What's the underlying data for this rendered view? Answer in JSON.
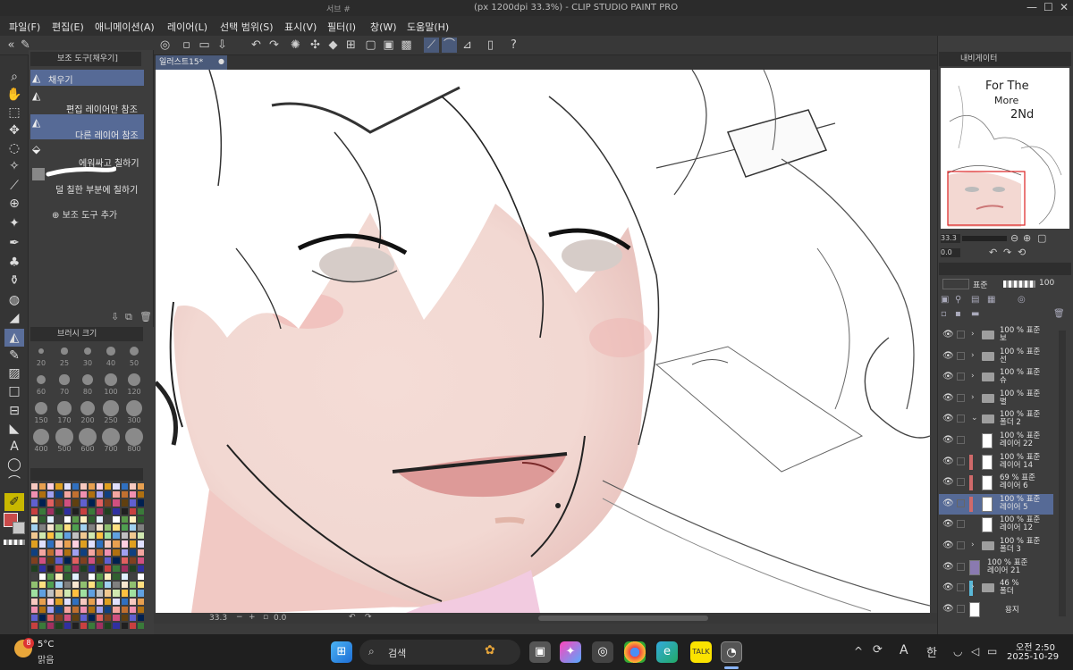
{
  "window": {
    "title_left": "서브 #",
    "title": "(px 1200dpi 33.3%) - CLIP STUDIO PAINT PRO",
    "min": "—",
    "max": "☐",
    "close": "✕"
  },
  "menu": [
    "파일(F)",
    "편집(E)",
    "애니메이션(A)",
    "레이어(L)",
    "선택 범위(S)",
    "표시(V)",
    "필터(I)",
    "창(W)",
    "도움말(H)"
  ],
  "subtool_panel": {
    "title": "보조 도구[채우기]",
    "header_item": "채우기",
    "items": [
      "편집 레이어만 참조",
      "다른 레이어 참조",
      "에워싸고 칠하기",
      "덜 칠한 부분에 칠하기"
    ],
    "add_label": "보조 도구 추가"
  },
  "brush_panel": {
    "title": "브러시 크기",
    "sizes": [
      "20",
      "25",
      "30",
      "40",
      "50",
      "60",
      "70",
      "80",
      "100",
      "120",
      "150",
      "170",
      "200",
      "250",
      "300",
      "400",
      "500",
      "600",
      "700",
      "800"
    ]
  },
  "canvas": {
    "tab_label": "일러스트15*",
    "zoom": "33.3",
    "angle": "0.0"
  },
  "navigator": {
    "title": "내비게이터",
    "thumb_text_1": "For The",
    "thumb_text_2": "More",
    "thumb_text_3": "2Nd",
    "zoom": "33.3",
    "angle": "0.0"
  },
  "layer_panel": {
    "blend": "표준",
    "opacity": "100",
    "layers": [
      {
        "line1": "100 % 표준",
        "line2": "보",
        "kind": "folder",
        "color": ""
      },
      {
        "line1": "100 % 표준",
        "line2": "선",
        "kind": "folder",
        "color": ""
      },
      {
        "line1": "100 % 표준",
        "line2": "슈",
        "kind": "folder",
        "color": ""
      },
      {
        "line1": "100 % 표준",
        "line2": "별",
        "kind": "folder",
        "color": ""
      },
      {
        "line1": "100 % 표준",
        "line2": "폴더 2",
        "kind": "folder-open",
        "color": ""
      },
      {
        "line1": "100 % 표준",
        "line2": "레이어 22",
        "kind": "layer",
        "color": ""
      },
      {
        "line1": "100 % 표준",
        "line2": "레이어 14",
        "kind": "layer",
        "color": "#d06a6a"
      },
      {
        "line1": "69 % 표준",
        "line2": "레이어 6",
        "kind": "layer",
        "color": "#d06a6a"
      },
      {
        "line1": "100 % 표준",
        "line2": "레이어 5",
        "kind": "layer",
        "color": "#d06a6a",
        "selected": true
      },
      {
        "line1": "100 % 표준",
        "line2": "레이어 12",
        "kind": "layer",
        "color": ""
      },
      {
        "line1": "100 % 표준",
        "line2": "폴더 3",
        "kind": "folder",
        "color": ""
      },
      {
        "line1": "100 % 표준",
        "line2": "레이어 21",
        "kind": "purple",
        "color": ""
      },
      {
        "line1": "46 %",
        "line2": "폴더",
        "kind": "folder",
        "color": "#5ab8d8"
      },
      {
        "line1": "",
        "line2": "용지",
        "kind": "paper",
        "color": ""
      }
    ]
  },
  "taskbar": {
    "weather_temp": "5°C",
    "weather_desc": "맑음",
    "weather_badge": "8",
    "search_placeholder": "검색",
    "ime_a": "A",
    "ime_han": "한",
    "time": "오전 2:50",
    "date": "2025-10-29",
    "up_arrow": "^"
  },
  "colors": {
    "accent": "#566a96",
    "main_color": "#c94a4a"
  }
}
